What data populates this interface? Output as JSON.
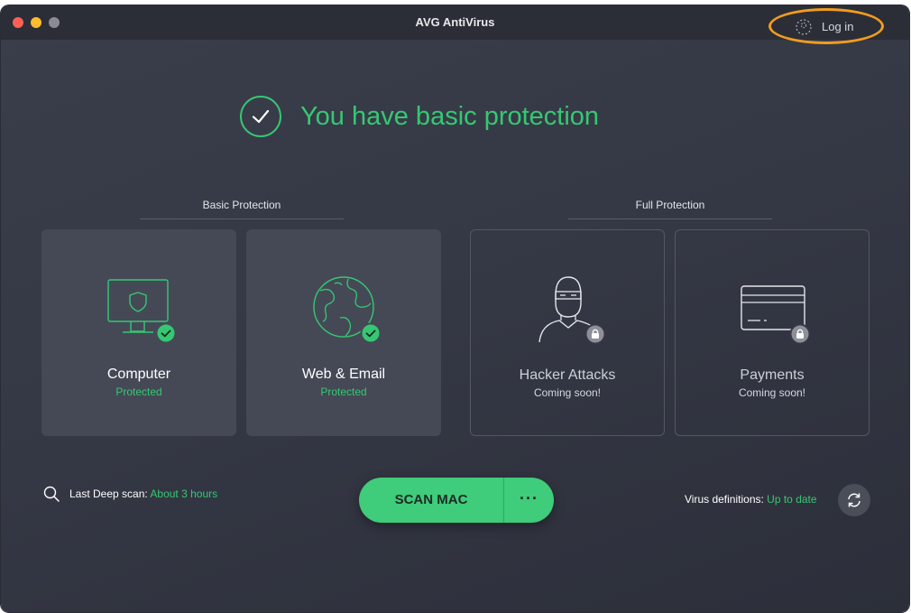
{
  "window": {
    "title": "AVG AntiVirus",
    "login_label": "Log in"
  },
  "status": {
    "headline": "You have basic protection"
  },
  "groups": {
    "basic": "Basic Protection",
    "full": "Full Protection"
  },
  "cards": [
    {
      "title": "Computer",
      "status": "Protected",
      "icon": "monitor-shield-icon",
      "badge": "check-badge-icon"
    },
    {
      "title": "Web & Email",
      "status": "Protected",
      "icon": "globe-icon",
      "badge": "check-badge-icon"
    },
    {
      "title": "Hacker Attacks",
      "status": "Coming soon!",
      "icon": "hacker-icon",
      "badge": "lock-badge-icon"
    },
    {
      "title": "Payments",
      "status": "Coming soon!",
      "icon": "credit-card-icon",
      "badge": "lock-badge-icon"
    }
  ],
  "scan": {
    "last_label": "Last Deep scan:",
    "last_value": "About 3 hours",
    "button_label": "SCAN MAC",
    "more_label": "···"
  },
  "definitions": {
    "label": "Virus definitions:",
    "value": "Up to date"
  },
  "colors": {
    "accent_green": "#35c872",
    "highlight_orange": "#f29c1f",
    "background": "#353945"
  }
}
